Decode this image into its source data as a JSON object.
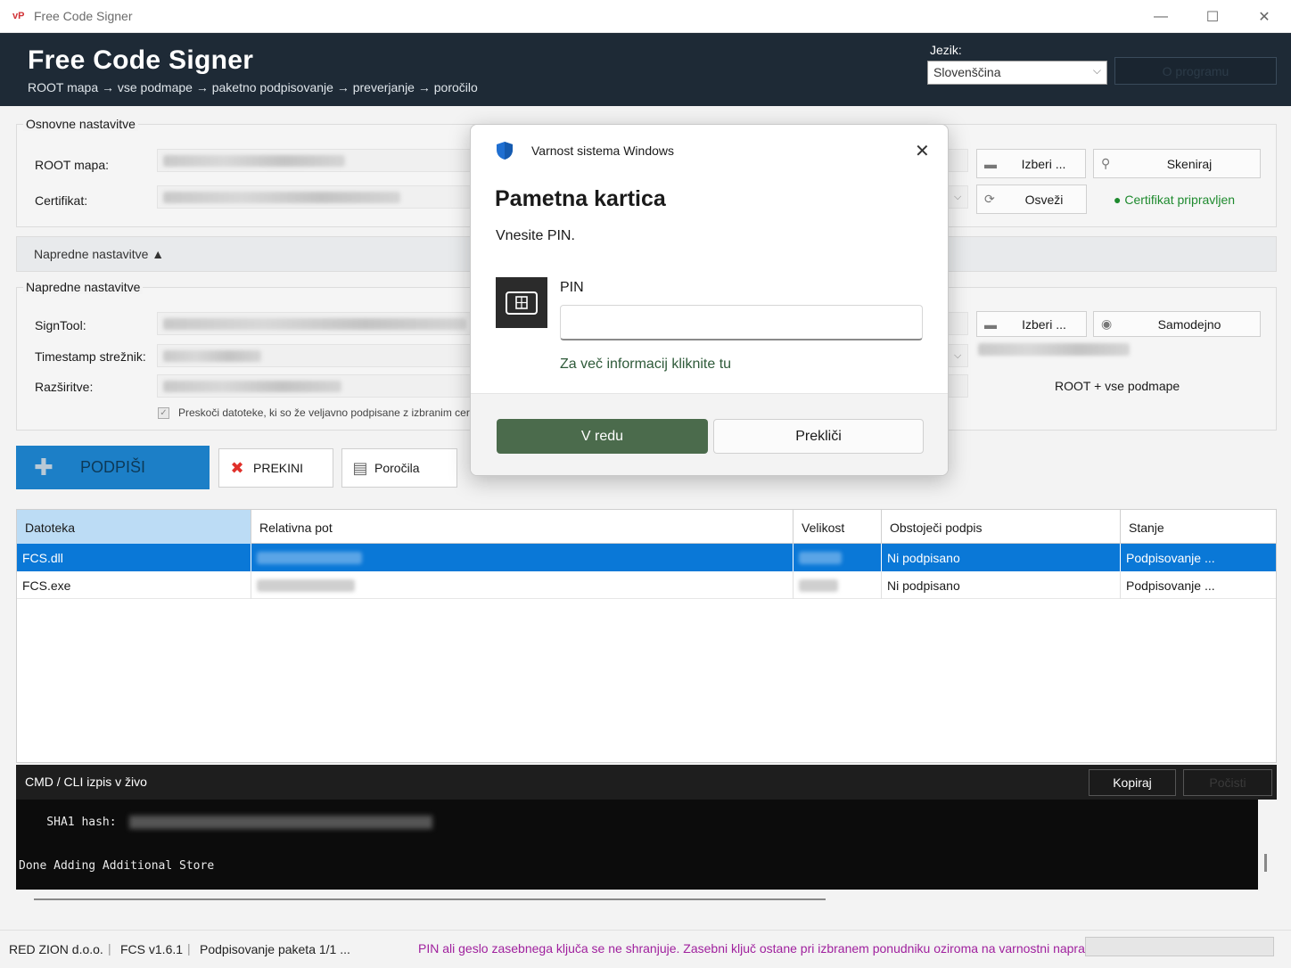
{
  "window": {
    "app_icon": "vP",
    "title": "Free Code Signer",
    "minimize": "—",
    "maximize": "☐",
    "close": "✕"
  },
  "header": {
    "title": "Free Code Signer",
    "subtitle": "ROOT mapa → vse podmape → paketno podpisovanje → preverjanje → poročilo",
    "language_label": "Jezik:",
    "language_value": "Slovenščina",
    "about_button": "O programu"
  },
  "basic": {
    "group_title": "Osnovne nastavitve",
    "root_label": "ROOT mapa:",
    "cert_label": "Certifikat:",
    "browse_button": "Izberi ...",
    "scan_button": "Skeniraj",
    "refresh_button": "Osveži",
    "cert_status": "● Certifikat pripravljen"
  },
  "advanced": {
    "toggle_label": "Napredne nastavitve ▲",
    "group_title": "Napredne nastavitve",
    "signtool_label": "SignTool:",
    "timestamp_label": "Timestamp strežnik:",
    "extensions_label": "Razširitve:",
    "browse_button": "Izberi ...",
    "auto_button": "Samodejno",
    "scope_text": "ROOT + vse podmape",
    "skip_signed_label": "Preskoči datoteke, ki so že veljavno podpisane z izbranim certifikatom",
    "skip_signed_checked": true
  },
  "actions": {
    "sign": "PODPIŠI",
    "abort": "PREKINI",
    "reports": "Poročila"
  },
  "table": {
    "columns": [
      "Datoteka",
      "Relativna pot",
      "Velikost",
      "Obstoječi podpis",
      "Stanje"
    ],
    "rows": [
      {
        "file": "FCS.dll",
        "signature": "Ni podpisano",
        "state": "Podpisovanje ...",
        "selected": true
      },
      {
        "file": "FCS.exe",
        "signature": "Ni podpisano",
        "state": "Podpisovanje ...",
        "selected": false
      }
    ]
  },
  "console": {
    "title": "CMD / CLI izpis v živo",
    "copy_button": "Kopiraj",
    "clear_button": "Počisti",
    "line1": "    SHA1 hash:",
    "line2": "Done Adding Additional Store"
  },
  "statusbar": {
    "company": "RED ZION d.o.o.",
    "version": "FCS v1.6.1",
    "progress_text": "Podpisovanje paketa 1/1 ...",
    "note": "PIN ali geslo zasebnega ključa se ne shranjuje. Zasebni ključ ostane pri izbranem ponudniku oziroma na varnostni napravi."
  },
  "dialog": {
    "source": "Varnost sistema Windows",
    "title": "Pametna kartica",
    "prompt": "Vnesite PIN.",
    "pin_label": "PIN",
    "pin_value": "",
    "more_info": "Za več informacij kliknite tu",
    "ok_button": "V redu",
    "cancel_button": "Prekliči",
    "close": "✕"
  },
  "colors": {
    "header_bg": "#1e2a36",
    "sign_button": "#1c7fc7",
    "selection": "#0a78d7",
    "ok_status": "#1e8a2e",
    "note_text": "#a0219e",
    "dialog_ok": "#4b6b4c"
  },
  "icons": {
    "shield": "shield-icon",
    "folder": "folder-icon",
    "search": "search-icon",
    "refresh": "refresh-icon",
    "eye": "eye-icon",
    "plus": "plus-icon",
    "abort": "x-icon",
    "document": "document-icon",
    "smartcard": "smartcard-icon"
  }
}
